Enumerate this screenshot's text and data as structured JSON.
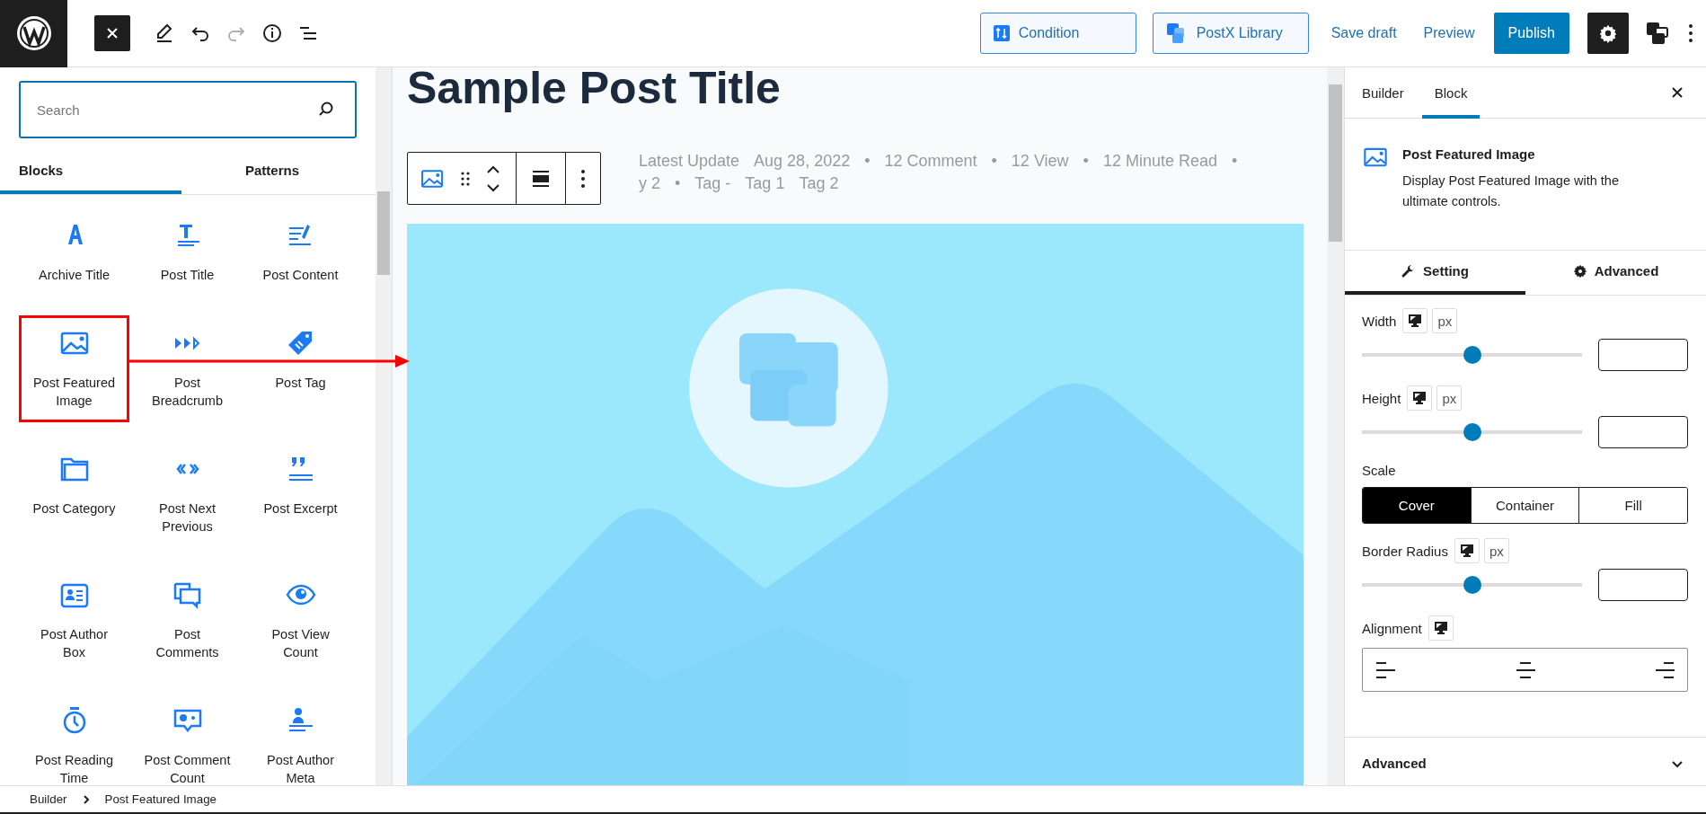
{
  "topbar": {
    "buttons": [
      {
        "label": "Condition",
        "kind": "outline"
      },
      {
        "label": "PostX Library",
        "kind": "outline"
      },
      {
        "label": "Save draft",
        "kind": "link"
      },
      {
        "label": "Preview",
        "kind": "link"
      },
      {
        "label": "Publish",
        "kind": "primary"
      }
    ]
  },
  "inserter": {
    "search": {
      "placeholder": "Search"
    },
    "tabs": [
      {
        "label": "Blocks",
        "selected": true
      },
      {
        "label": "Patterns",
        "selected": false
      }
    ],
    "blocks": [
      {
        "label": "Archive Title",
        "highlighted": false
      },
      {
        "label": "Post Title",
        "highlighted": false
      },
      {
        "label": "Post Content",
        "highlighted": false
      },
      {
        "label": "Post Featured Image",
        "highlighted": true
      },
      {
        "label": "Post Breadcrumb",
        "highlighted": false
      },
      {
        "label": "Post Tag",
        "highlighted": false
      },
      {
        "label": "Post Category",
        "highlighted": false
      },
      {
        "label": "Post Next Previous",
        "highlighted": false
      },
      {
        "label": "Post Excerpt",
        "highlighted": false
      },
      {
        "label": "Post Author Box",
        "highlighted": false
      },
      {
        "label": "Post Comments",
        "highlighted": false
      },
      {
        "label": "Post View Count",
        "highlighted": false
      },
      {
        "label": "Post Reading Time",
        "highlighted": false
      },
      {
        "label": "Post Comment Count",
        "highlighted": false
      },
      {
        "label": "Post Author Meta",
        "highlighted": false
      }
    ]
  },
  "canvas": {
    "title": "Sample Post Title",
    "meta_lines": [
      [
        "Latest Update",
        "Aug 28, 2022",
        "•",
        "12 Comment",
        "•",
        "12 View",
        "•",
        "12 Minute Read",
        "•"
      ],
      [
        "y 2",
        "•",
        "Tag -",
        "Tag 1",
        "Tag 2"
      ]
    ]
  },
  "sidebar": {
    "tabs": [
      {
        "label": "Builder",
        "selected": false
      },
      {
        "label": "Block",
        "selected": true
      }
    ],
    "block": {
      "title": "Post Featured Image",
      "description": "Display Post Featured Image with the ultimate controls."
    },
    "setting_tabs": [
      {
        "label": "Setting",
        "selected": true
      },
      {
        "label": "Advanced",
        "selected": false
      }
    ],
    "controls": [
      {
        "kind": "slider",
        "label": "Width",
        "unit": "px",
        "level": 0.5
      },
      {
        "kind": "slider",
        "label": "Height",
        "unit": "px",
        "level": 0.5
      },
      {
        "kind": "segmented",
        "label": "Scale",
        "options": [
          {
            "label": "Cover",
            "selected": true
          },
          {
            "label": "Container",
            "selected": false
          },
          {
            "label": "Fill",
            "selected": false
          }
        ]
      },
      {
        "kind": "slider",
        "label": "Border Radius",
        "unit": "px",
        "level": 0.5
      },
      {
        "kind": "alignment",
        "label": "Alignment"
      }
    ],
    "sections": [
      {
        "label": "Advanced",
        "expanded": false
      }
    ]
  },
  "breadcrumb": [
    "Builder",
    "Post Featured Image"
  ]
}
